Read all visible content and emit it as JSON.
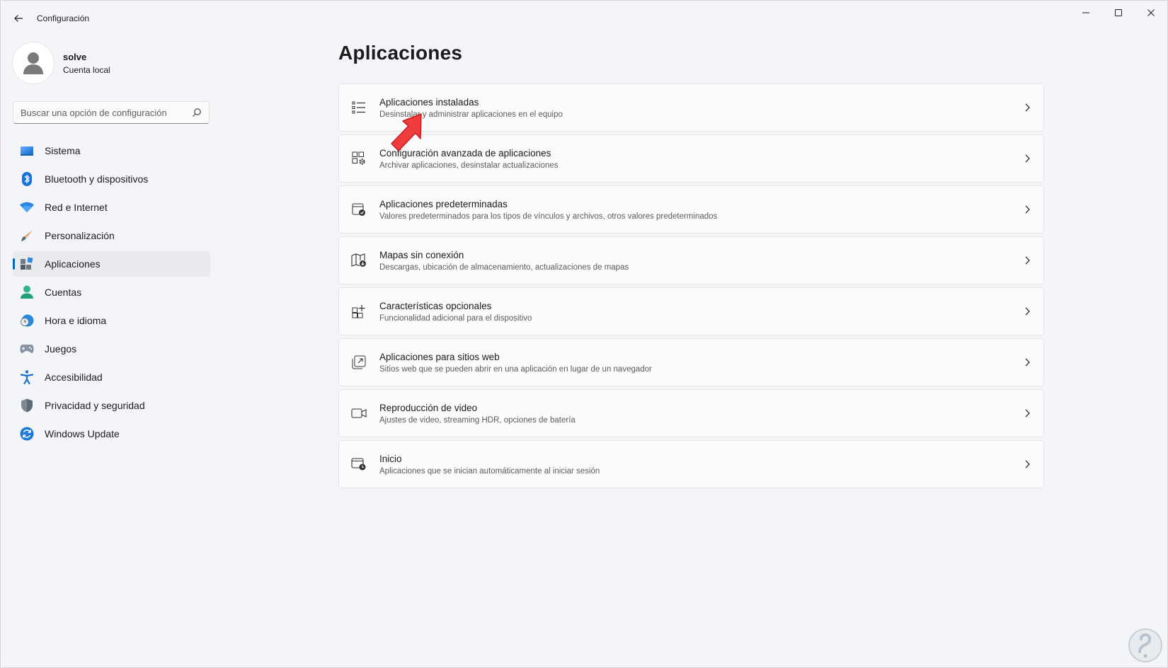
{
  "window": {
    "title": "Configuración"
  },
  "profile": {
    "name": "solve",
    "account_type": "Cuenta local"
  },
  "search": {
    "placeholder": "Buscar una opción de configuración"
  },
  "sidebar": {
    "items": [
      {
        "label": "Sistema",
        "icon": "system-icon",
        "active": false
      },
      {
        "label": "Bluetooth y dispositivos",
        "icon": "bluetooth-icon",
        "active": false
      },
      {
        "label": "Red e Internet",
        "icon": "wifi-icon",
        "active": false
      },
      {
        "label": "Personalización",
        "icon": "brush-icon",
        "active": false
      },
      {
        "label": "Aplicaciones",
        "icon": "apps-icon",
        "active": true
      },
      {
        "label": "Cuentas",
        "icon": "accounts-icon",
        "active": false
      },
      {
        "label": "Hora e idioma",
        "icon": "time-language-icon",
        "active": false
      },
      {
        "label": "Juegos",
        "icon": "gamepad-icon",
        "active": false
      },
      {
        "label": "Accesibilidad",
        "icon": "accessibility-icon",
        "active": false
      },
      {
        "label": "Privacidad y seguridad",
        "icon": "shield-icon",
        "active": false
      },
      {
        "label": "Windows Update",
        "icon": "update-icon",
        "active": false
      }
    ]
  },
  "main": {
    "title": "Aplicaciones",
    "cards": [
      {
        "title": "Aplicaciones instaladas",
        "description": "Desinstalar y administrar aplicaciones en el equipo",
        "icon": "list-icon"
      },
      {
        "title": "Configuración avanzada de aplicaciones",
        "description": "Archivar aplicaciones, desinstalar actualizaciones",
        "icon": "advanced-settings-icon"
      },
      {
        "title": "Aplicaciones predeterminadas",
        "description": "Valores predeterminados para los tipos de vínculos y archivos, otros valores predeterminados",
        "icon": "default-apps-icon"
      },
      {
        "title": "Mapas sin conexión",
        "description": "Descargas, ubicación de almacenamiento, actualizaciones de mapas",
        "icon": "map-icon"
      },
      {
        "title": "Características opcionales",
        "description": "Funcionalidad adicional para el dispositivo",
        "icon": "optional-features-icon"
      },
      {
        "title": "Aplicaciones para sitios web",
        "description": "Sitios web que se pueden abrir en una aplicación en lugar de un navegador",
        "icon": "web-apps-icon"
      },
      {
        "title": "Reproducción de video",
        "description": "Ajustes de video, streaming HDR, opciones de batería",
        "icon": "video-icon"
      },
      {
        "title": "Inicio",
        "description": "Aplicaciones que se inician automáticamente al iniciar sesión",
        "icon": "startup-icon"
      }
    ]
  },
  "colors": {
    "accent": "#0067c0",
    "annotation_arrow": "#ef3b3b",
    "background": "#f3f5f9"
  }
}
